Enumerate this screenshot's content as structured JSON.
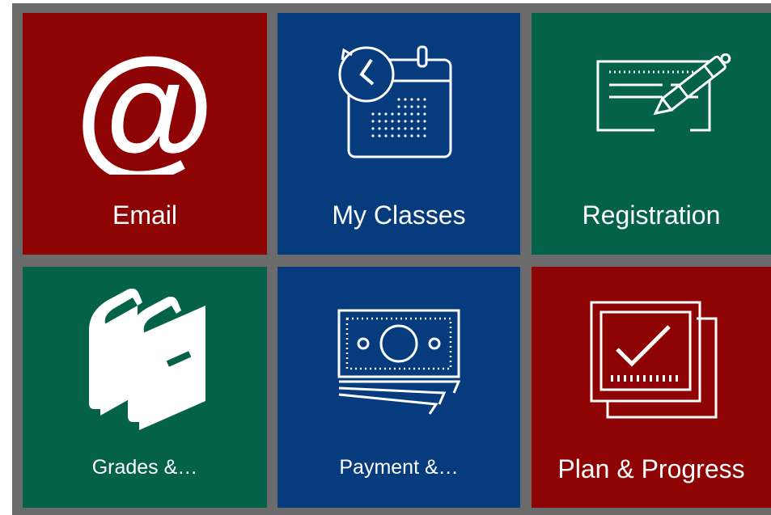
{
  "tiles": [
    {
      "label": "Email",
      "icon": "at-sign-icon",
      "color": "#8e0303"
    },
    {
      "label": "My Classes",
      "icon": "calendar-clock-icon",
      "color": "#063b7d"
    },
    {
      "label": "Registration",
      "icon": "form-pen-icon",
      "color": "#05624a"
    },
    {
      "label": "Grades &…",
      "icon": "books-icon",
      "color": "#05624a"
    },
    {
      "label": "Payment &…",
      "icon": "money-icon",
      "color": "#063b7d"
    },
    {
      "label": "Plan & Progress",
      "icon": "checklist-screen-icon",
      "color": "#8e0303"
    }
  ]
}
